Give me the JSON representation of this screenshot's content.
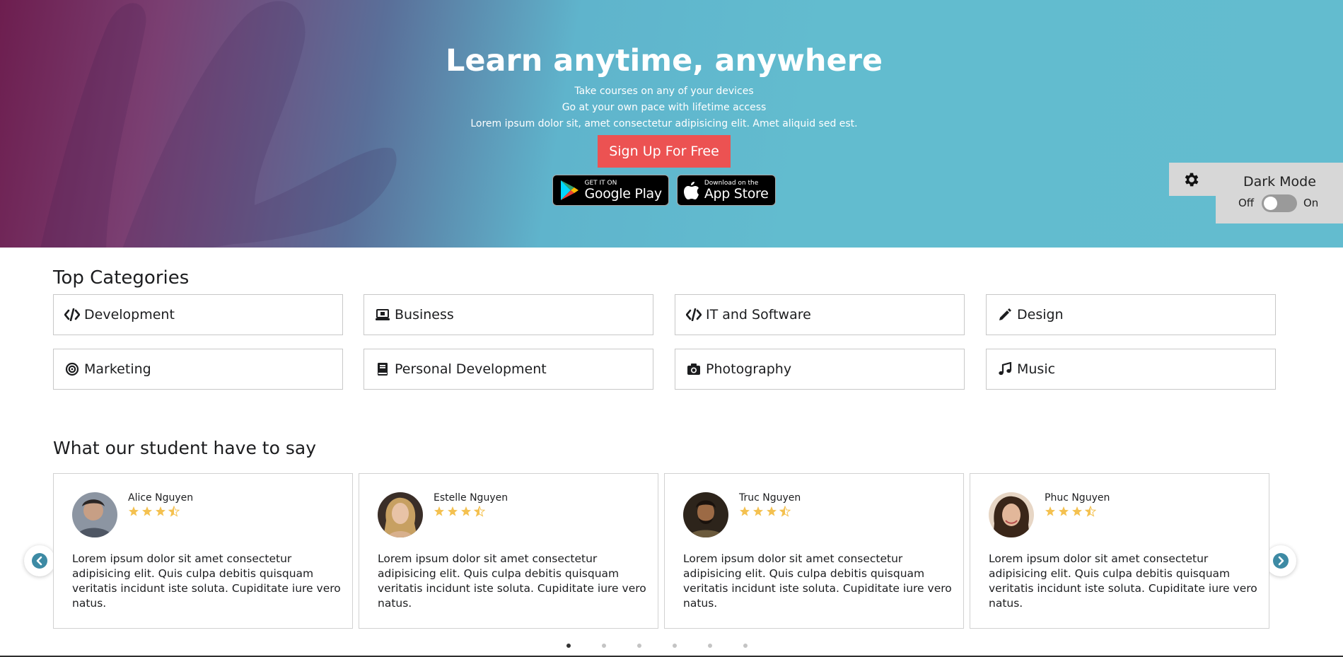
{
  "hero": {
    "title": "Learn anytime, anywhere",
    "lines": [
      "Take courses on any of your devices",
      "Go at your own pace with lifetime access",
      "Lorem ipsum dolor sit, amet consectetur adipisicing elit. Amet aliquid sed est."
    ],
    "signup_label": "Sign Up For Free",
    "google_play": {
      "small": "GET IT ON",
      "big": "Google Play",
      "icon": "google-play-icon"
    },
    "app_store": {
      "small": "Download on the",
      "big": "App Store",
      "icon": "apple-icon"
    }
  },
  "dark_mode": {
    "title": "Dark Mode",
    "off_label": "Off",
    "on_label": "On",
    "enabled": false,
    "icon": "gear-icon"
  },
  "categories": {
    "title": "Top Categories",
    "items": [
      {
        "label": "Development",
        "icon": "code-icon"
      },
      {
        "label": "Business",
        "icon": "laptop-icon"
      },
      {
        "label": "IT and Software",
        "icon": "code-icon"
      },
      {
        "label": "Design",
        "icon": "pencil-icon"
      },
      {
        "label": "Marketing",
        "icon": "bullseye-icon"
      },
      {
        "label": "Personal Development",
        "icon": "book-icon"
      },
      {
        "label": "Photography",
        "icon": "camera-icon"
      },
      {
        "label": "Music",
        "icon": "music-note-icon"
      }
    ]
  },
  "testimonials": {
    "title": "What our student have to say",
    "rating": 3.5,
    "items": [
      {
        "name": "Alice Nguyen",
        "text": "Lorem ipsum dolor sit amet consectetur adipisicing elit. Quis culpa debitis quisquam veritatis incidunt iste soluta. Cupiditate iure vero natus."
      },
      {
        "name": "Estelle Nguyen",
        "text": "Lorem ipsum dolor sit amet consectetur adipisicing elit. Quis culpa debitis quisquam veritatis incidunt iste soluta. Cupiditate iure vero natus."
      },
      {
        "name": "Truc Nguyen",
        "text": "Lorem ipsum dolor sit amet consectetur adipisicing elit. Quis culpa debitis quisquam veritatis incidunt iste soluta. Cupiditate iure vero natus."
      },
      {
        "name": "Phuc Nguyen",
        "text": "Lorem ipsum dolor sit amet consectetur adipisicing elit. Quis culpa debitis quisquam veritatis incidunt iste soluta. Cupiditate iure vero natus."
      }
    ],
    "page_count": 6,
    "active_page": 1
  },
  "colors": {
    "accent_red": "#ec5252",
    "star": "#f4c150",
    "arrow": "#3d8aa4"
  }
}
